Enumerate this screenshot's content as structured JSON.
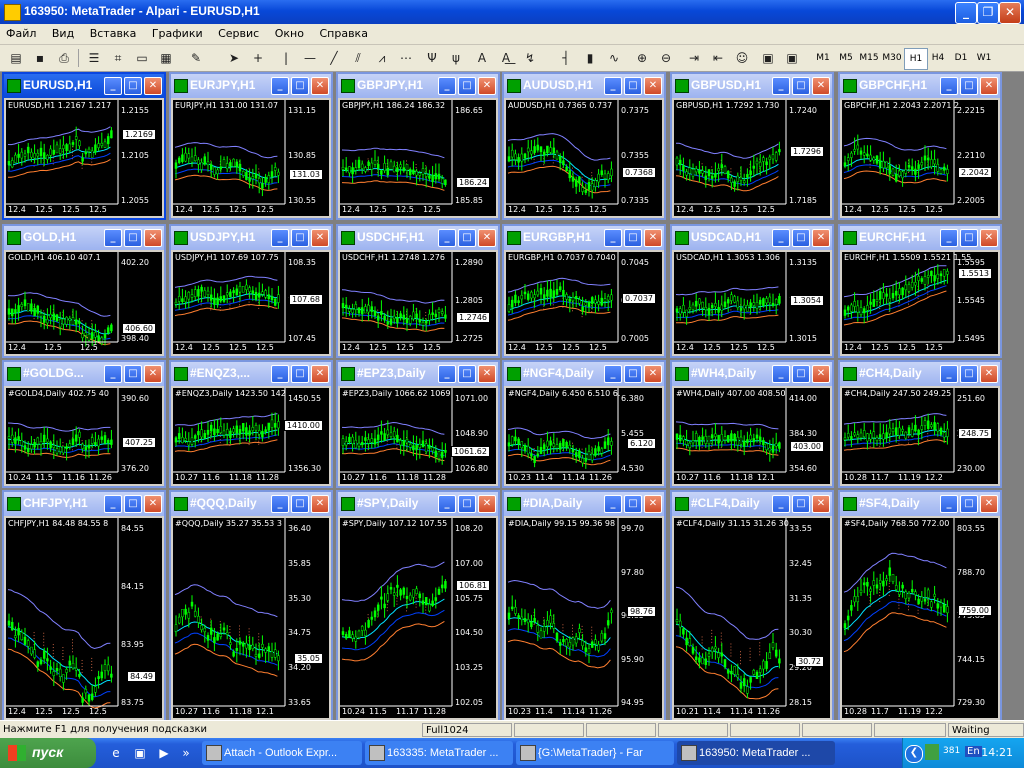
{
  "window": {
    "title": "163950: MetaTrader - Alpari - EURUSD,H1"
  },
  "menu": [
    "Файл",
    "Вид",
    "Вставка",
    "Графики",
    "Сервис",
    "Окно",
    "Справка"
  ],
  "timeframes": [
    "M1",
    "M5",
    "M15",
    "M30",
    "H1",
    "H4",
    "D1",
    "W1"
  ],
  "active_timeframe": "H1",
  "charts": [
    {
      "cap": "EURUSD,H1",
      "label": "EURUSD,H1  1.2167  1.217",
      "ticks": [
        "1.2155",
        "1.2105",
        "1.2055"
      ],
      "price": "1.2169",
      "dates": [
        "12.4",
        "12.5",
        "12.5",
        "12.5"
      ],
      "active": true
    },
    {
      "cap": "EURJPY,H1",
      "label": "EURJPY,H1  131.00  131.07",
      "ticks": [
        "131.15",
        "130.85",
        "130.55"
      ],
      "price": "131.03",
      "dates": [
        "12.4",
        "12.5",
        "12.5",
        "12.5"
      ]
    },
    {
      "cap": "GBPJPY,H1",
      "label": "GBPJPY,H1  186.24  186.32",
      "ticks": [
        "186.65",
        "185.85"
      ],
      "price": "186.24",
      "dates": [
        "12.4",
        "12.5",
        "12.5",
        "12.5"
      ]
    },
    {
      "cap": "AUDUSD,H1",
      "label": "AUDUSD,H1  0.7365  0.737",
      "ticks": [
        "0.7375",
        "0.7355",
        "0.7335"
      ],
      "price": "0.7368",
      "dates": [
        "12.4",
        "12.5",
        "12.5",
        "12.5"
      ]
    },
    {
      "cap": "GBPUSD,H1",
      "label": "GBPUSD,H1  1.7292  1.730",
      "ticks": [
        "1.7240",
        "1.7185"
      ],
      "price": "1.7296",
      "dates": [
        "12.4",
        "12.5",
        "12.5",
        "12.5"
      ]
    },
    {
      "cap": "GBPCHF,H1",
      "label": "GBPCHF,H1  2.2043  2.2071  2.",
      "ticks": [
        "2.2215",
        "2.2110",
        "2.2005"
      ],
      "price": "2.2042",
      "dates": [
        "12.4",
        "12.5",
        "12.5",
        "12.5"
      ]
    },
    {
      "cap": "GOLD,H1",
      "label": "GOLD,H1  406.10  407.1",
      "ticks": [
        "402.20",
        "398.40"
      ],
      "price": "406.60",
      "dates": [
        "12.4",
        "12.5",
        "12.5"
      ]
    },
    {
      "cap": "USDJPY,H1",
      "label": "USDJPY,H1  107.69  107.75",
      "ticks": [
        "108.35",
        "107.90",
        "107.45"
      ],
      "price": "107.68",
      "dates": [
        "12.4",
        "12.5",
        "12.5",
        "12.5"
      ]
    },
    {
      "cap": "USDCHF,H1",
      "label": "USDCHF,H1  1.2748  1.276",
      "ticks": [
        "1.2890",
        "1.2805",
        "1.2725"
      ],
      "price": "1.2746",
      "dates": [
        "12.4",
        "12.5",
        "12.5",
        "12.5"
      ]
    },
    {
      "cap": "EURGBP,H1",
      "label": "EURGBP,H1  0.7037  0.7040",
      "ticks": [
        "0.7045",
        "0.7025",
        "0.7005"
      ],
      "price": "0.7037",
      "dates": [
        "12.4",
        "12.5",
        "12.5",
        "12.5"
      ]
    },
    {
      "cap": "USDCAD,H1",
      "label": "USDCAD,H1  1.3053  1.306",
      "ticks": [
        "1.3135",
        "1.3075",
        "1.3015"
      ],
      "price": "1.3054",
      "dates": [
        "12.4",
        "12.5",
        "12.5",
        "12.5"
      ]
    },
    {
      "cap": "EURCHF,H1",
      "label": "EURCHF,H1  1.5509  1.5521  1.55",
      "ticks": [
        "1.5595",
        "1.5545",
        "1.5495"
      ],
      "price": "1.5513",
      "dates": [
        "12.4",
        "12.5",
        "12.5",
        "12.5"
      ]
    },
    {
      "cap": "#GOLDG...",
      "label": "#GOLD4,Daily  402.75  40",
      "ticks": [
        "390.60",
        "376.20"
      ],
      "price": "407.25",
      "dates": [
        "10.24",
        "11.5",
        "11.16",
        "11.26"
      ]
    },
    {
      "cap": "#ENQZ3,...",
      "label": "#ENQZ3,Daily  1423.50  142",
      "ticks": [
        "1450.55",
        "1356.30"
      ],
      "price": "1410.00",
      "dates": [
        "10.27",
        "11.6",
        "11.18",
        "11.28"
      ]
    },
    {
      "cap": "#EPZ3,Daily",
      "label": "#EPZ3,Daily  1066.62  1069",
      "ticks": [
        "1071.00",
        "1048.90",
        "1026.80"
      ],
      "price": "1061.62",
      "dates": [
        "10.27",
        "11.6",
        "11.18",
        "11.28"
      ]
    },
    {
      "cap": "#NGF4,Daily",
      "label": "#NGF4,Daily  6.450  6.510  6.",
      "ticks": [
        "6.380",
        "5.455",
        "4.530"
      ],
      "price": "6.120",
      "dates": [
        "10.23",
        "11.4",
        "11.14",
        "11.26"
      ]
    },
    {
      "cap": "#WH4,Daily",
      "label": "#WH4,Daily  407.00  408.50",
      "ticks": [
        "414.00",
        "384.30",
        "354.60"
      ],
      "price": "403.00",
      "dates": [
        "10.27",
        "11.6",
        "11.18",
        "12.1"
      ]
    },
    {
      "cap": "#CH4,Daily",
      "label": "#CH4,Daily  247.50  249.25",
      "ticks": [
        "251.60",
        "240.80",
        "230.00"
      ],
      "price": "248.75",
      "dates": [
        "10.28",
        "11.7",
        "11.19",
        "12.2"
      ]
    },
    {
      "cap": "CHFJPY,H1",
      "label": "CHFJPY,H1  84.48  84.55  8",
      "ticks": [
        "84.55",
        "84.15",
        "83.95",
        "83.75"
      ],
      "price": "84.49",
      "dates": [
        "12.4",
        "12.5",
        "12.5",
        "12.5"
      ]
    },
    {
      "cap": "#QQQ,Daily",
      "label": "#QQQ,Daily  35.27  35.53  3",
      "ticks": [
        "36.40",
        "35.85",
        "35.30",
        "34.75",
        "34.20",
        "33.65"
      ],
      "price": "35.05",
      "dates": [
        "10.27",
        "11.6",
        "11.18",
        "12.1"
      ]
    },
    {
      "cap": "#SPY,Daily",
      "label": "#SPY,Daily  107.12  107.55",
      "ticks": [
        "108.20",
        "107.00",
        "105.75",
        "104.50",
        "103.25",
        "102.05"
      ],
      "price": "106.81",
      "dates": [
        "10.24",
        "11.5",
        "11.17",
        "11.28"
      ]
    },
    {
      "cap": "#DIA,Daily",
      "label": "#DIA,Daily  99.15  99.36  98",
      "ticks": [
        "99.70",
        "97.80",
        "96.85",
        "95.90",
        "94.95"
      ],
      "price": "98.76",
      "dates": [
        "10.23",
        "11.4",
        "11.14",
        "11.26"
      ]
    },
    {
      "cap": "#CLF4,Daily",
      "label": "#CLF4,Daily  31.15  31.26  30",
      "ticks": [
        "33.55",
        "32.45",
        "31.35",
        "30.30",
        "29.20",
        "28.15"
      ],
      "price": "30.72",
      "dates": [
        "10.21",
        "11.4",
        "11.14",
        "11.26"
      ]
    },
    {
      "cap": "#SF4,Daily",
      "label": "#SF4,Daily  768.50  772.00",
      "ticks": [
        "803.55",
        "788.70",
        "773.85",
        "744.15",
        "729.30"
      ],
      "price": "759.00",
      "dates": [
        "10.28",
        "11.7",
        "11.19",
        "12.2"
      ]
    }
  ],
  "status": {
    "hint": "Нажмите F1 для получения подсказки",
    "profile": "Full1024",
    "conn": "Waiting"
  },
  "taskbar": {
    "start": "пуск",
    "tasks": [
      "Attach - Outlook Expr...",
      "163335: MetaTrader ...",
      "{G:\\MetaTrader} - Far",
      "163950: MetaTrader ..."
    ],
    "active_task": 3,
    "tray_num": "381",
    "lang": "En",
    "clock": "14:21"
  },
  "colors": {
    "bull": "#00ff00",
    "ma1": "#00e0ff",
    "ma2": "#0040ff",
    "ma3": "#ff7f30",
    "band": "#8080ff"
  }
}
